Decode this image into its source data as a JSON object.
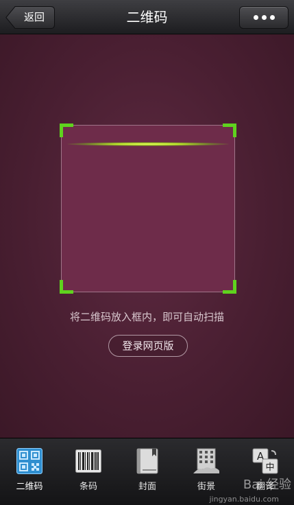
{
  "header": {
    "title": "二维码",
    "back_label": "返回",
    "more_icon": "more-dots-icon"
  },
  "scanner": {
    "hint": "将二维码放入框内，即可自动扫描",
    "login_label": "登录网页版",
    "corner_color": "#5fd31e",
    "line_color": "#b9e62a"
  },
  "toolbar": {
    "items": [
      {
        "label": "二维码",
        "icon": "qr-code-icon",
        "active": true
      },
      {
        "label": "条码",
        "icon": "barcode-icon"
      },
      {
        "label": "封面",
        "icon": "book-cover-icon"
      },
      {
        "label": "街景",
        "icon": "street-view-icon"
      },
      {
        "label": "翻译",
        "icon": "translate-icon"
      }
    ],
    "accent": "#3aa6e6"
  },
  "watermark": {
    "text": "Bai 经验",
    "url": "jingyan.baidu.com"
  }
}
